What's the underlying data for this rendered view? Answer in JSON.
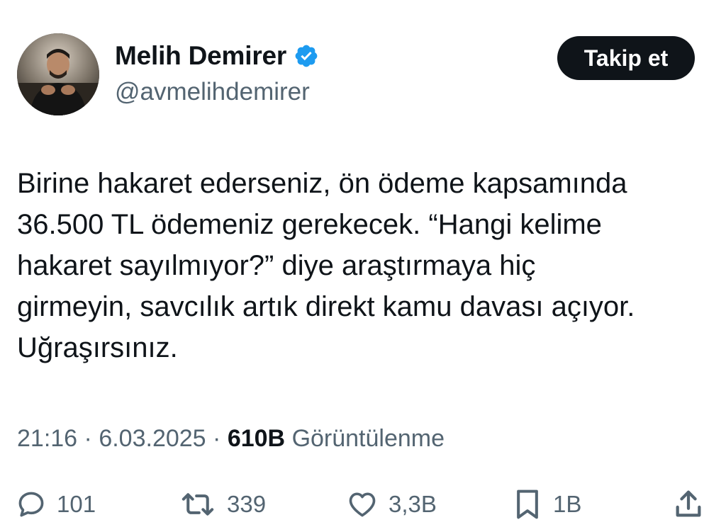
{
  "author": {
    "display_name": "Melih Demirer",
    "handle": "@avmelihdemirer",
    "verified": true
  },
  "follow_button": {
    "label": "Takip et"
  },
  "tweet": {
    "lines": [
      "Birine hakaret ederseniz, ön ödeme kapsamında",
      "36.500 TL ödemeniz gerekecek. “Hangi kelime",
      "hakaret sayılmıyor?” diye araştırmaya hiç",
      "girmeyin, savcılık artık direkt kamu davası açıyor.",
      "Uğraşırsınız."
    ]
  },
  "meta": {
    "time": "21:16",
    "date": "6.03.2025",
    "views_count": "610B",
    "views_label": "Görüntülenme",
    "separator": "·"
  },
  "actions": {
    "reply_count": "101",
    "repost_count": "339",
    "like_count": "3,3B",
    "bookmark_count": "1B"
  },
  "colors": {
    "text": "#0f1419",
    "secondary": "#536471",
    "verified": "#1d9bf0",
    "button_bg": "#0f1419"
  }
}
